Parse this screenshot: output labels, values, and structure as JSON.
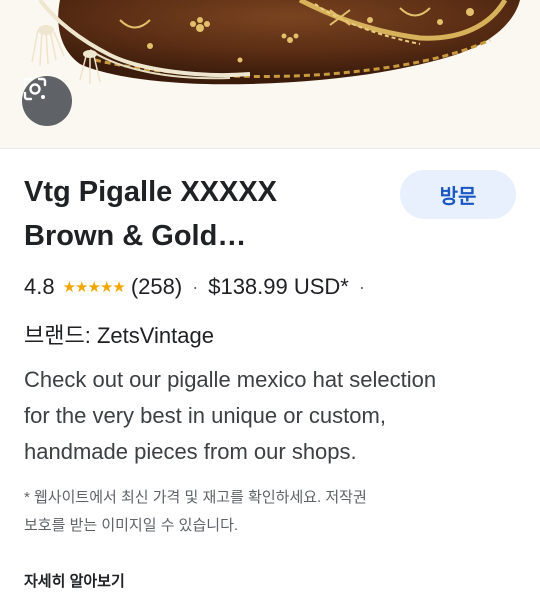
{
  "image": {
    "lens_icon": "lens-search-icon"
  },
  "product": {
    "title_line1": "Vtg Pigalle XXXXX",
    "title_line2": "Brown & Gold…",
    "visit_label": "방문",
    "rating_value": "4.8",
    "rating_stars": 5,
    "review_count": "(258)",
    "dot1": "·",
    "price": "$138.99 USD*",
    "dot2": "·",
    "brand_text": "브랜드: ZetsVintage",
    "description_lines": [
      "Check out our pigalle mexico hat selection",
      "for the very best in unique or custom,",
      "handmade pieces from our shops."
    ],
    "disclaimer_line1": "* 웹사이트에서 최신 가격 및 재고를 확인하세요. 저작권",
    "disclaimer_line2": "보호를 받는 이미지일 수 있습니다.",
    "learn_more": "자세히 알아보기"
  },
  "colors": {
    "accent": "#1a56c4",
    "visit_bg": "#e8f0fe",
    "star": "#f2a600",
    "hat_brown": "#5a2d14",
    "gold": "#d8b25a"
  }
}
